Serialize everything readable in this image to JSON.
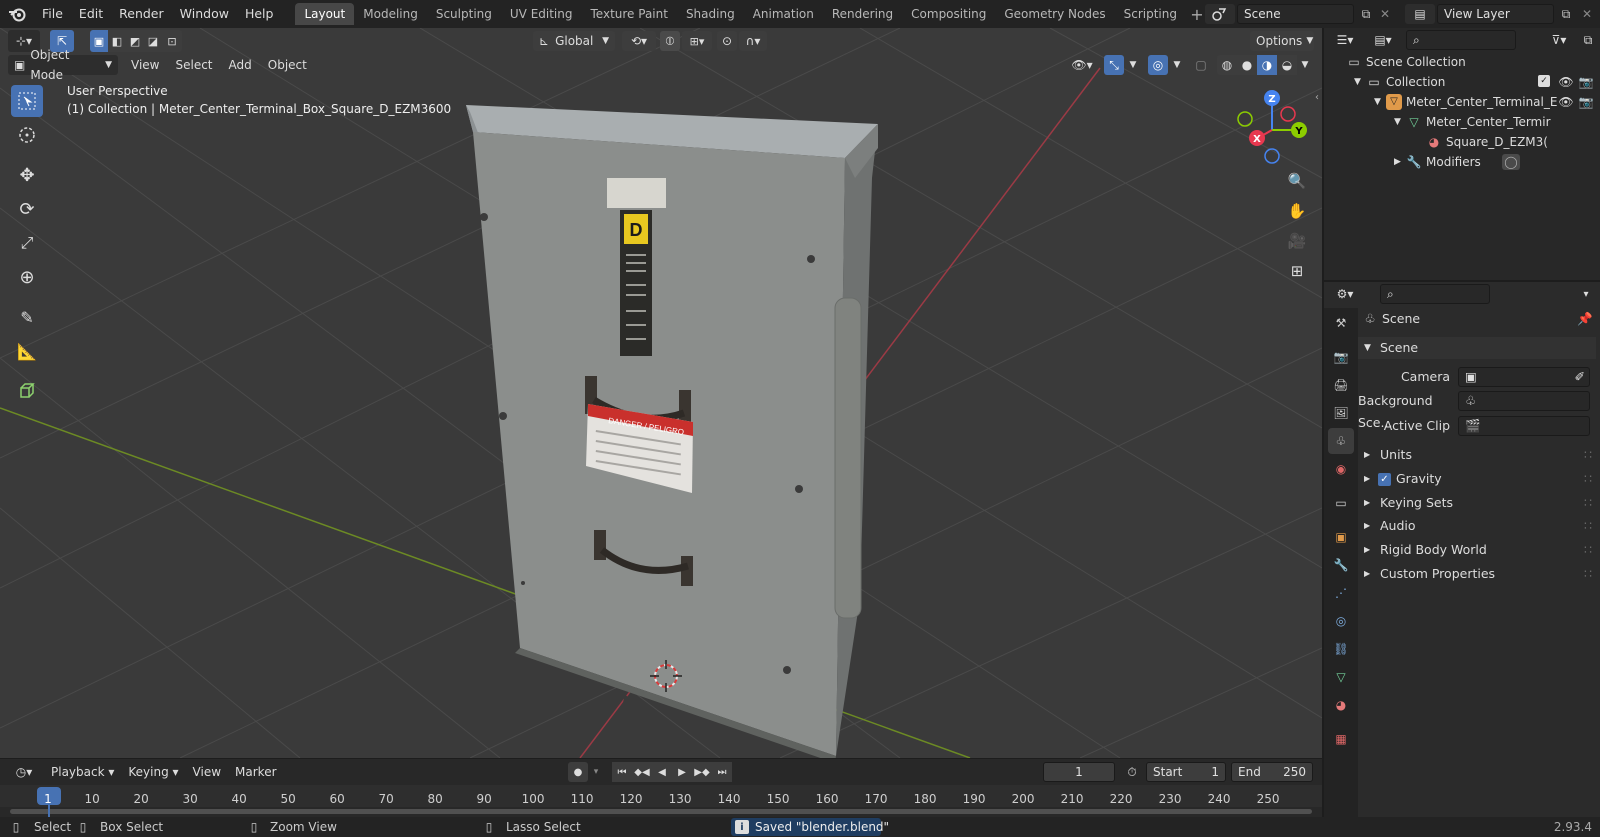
{
  "menu": [
    "File",
    "Edit",
    "Render",
    "Window",
    "Help"
  ],
  "workspaces": [
    "Layout",
    "Modeling",
    "Sculpting",
    "UV Editing",
    "Texture Paint",
    "Shading",
    "Animation",
    "Rendering",
    "Compositing",
    "Geometry Nodes",
    "Scripting"
  ],
  "active_workspace": "Layout",
  "scene_name": "Scene",
  "view_layer": "View Layer",
  "header": {
    "orientation": "Global",
    "options": "Options",
    "mode": "Object Mode",
    "view_menu": [
      "View",
      "Select",
      "Add",
      "Object"
    ]
  },
  "viewport": {
    "perspective": "User Perspective",
    "object_info": "(1) Collection | Meter_Center_Terminal_Box_Square_D_EZM3600"
  },
  "gizmo": {
    "x": "X",
    "y": "Y",
    "z": "Z"
  },
  "model_labels": {
    "brand_logo": "D",
    "warning": "DANGER / PELIGRO"
  },
  "outliner": {
    "scene_collection": "Scene Collection",
    "collection": "Collection",
    "object": "Meter_Center_Terminal_E",
    "mesh": "Meter_Center_Termir",
    "material": "Square_D_EZM3(",
    "modifiers": "Modifiers"
  },
  "properties": {
    "header": "Scene",
    "panel": "Scene",
    "camera_label": "Camera",
    "background_label": "Background Sce...",
    "clip_label": "Active Clip",
    "gravity": "Gravity",
    "sections": [
      "Units",
      "Keying Sets",
      "Audio",
      "Rigid Body World",
      "Custom Properties"
    ]
  },
  "timeline": {
    "menus": [
      "Playback",
      "Keying",
      "View",
      "Marker"
    ],
    "current_frame": "1",
    "start_label": "Start",
    "start": "1",
    "end_label": "End",
    "end": "250",
    "ticks": [
      "1",
      "10",
      "20",
      "30",
      "40",
      "50",
      "60",
      "70",
      "80",
      "90",
      "100",
      "110",
      "120",
      "130",
      "140",
      "150",
      "160",
      "170",
      "180",
      "190",
      "200",
      "210",
      "220",
      "230",
      "240",
      "250"
    ]
  },
  "status": {
    "select": "Select",
    "box_select": "Box Select",
    "zoom": "Zoom View",
    "lasso": "Lasso Select",
    "message": "Saved \"blender.blend\"",
    "version": "2.93.4"
  },
  "colors": {
    "accent": "#4772b3",
    "x_axis": "#e8384f",
    "y_axis": "#8ccd00",
    "z_axis": "#4684f0"
  }
}
